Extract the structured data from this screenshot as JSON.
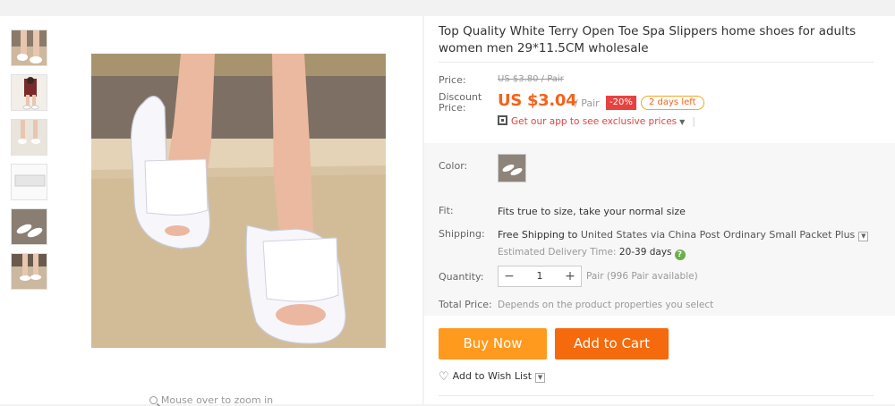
{
  "gallery": {
    "zoom_hint": "Mouse over to zoom in",
    "thumbnails": [
      "slippers-worn-1",
      "slippers-model",
      "slippers-pair",
      "slippers-packaged",
      "slippers-floor",
      "slippers-worn-2"
    ]
  },
  "product": {
    "title": "Top Quality White Terry Open Toe Spa Slippers home shoes for adults women men 29*11.5CM wholesale"
  },
  "price": {
    "price_label": "Price:",
    "original": "US $3.80 / Pair",
    "discount_label_1": "Discount",
    "discount_label_2": "Price:",
    "discount_value": "US $3.04",
    "per_unit": "/ Pair",
    "discount_pct": "-20%",
    "days_left": "2 days left",
    "app_link": "Get our app to see exclusive prices"
  },
  "props": {
    "color_label": "Color:",
    "fit_label": "Fit:",
    "fit_value": "Fits true to size, take your normal size",
    "shipping_label": "Shipping:",
    "shipping_free": "Free Shipping",
    "shipping_to": "to",
    "shipping_country": "United States via China Post Ordinary Small Packet Plus",
    "est_label": "Estimated Delivery Time:",
    "est_days": "20-39 days",
    "qty_label": "Quantity:",
    "qty_value": "1",
    "qty_available": "Pair (996 Pair available)",
    "total_label": "Total Price:",
    "total_value": "Depends on the product properties you select"
  },
  "actions": {
    "buy_now": "Buy Now",
    "add_to_cart": "Add to Cart",
    "wish_list": "Add to Wish List"
  },
  "colors": {
    "accent_orange": "#f5621a",
    "buy_button": "#ff9a1f",
    "cart_button": "#f56a0c",
    "badge_red": "#e64340"
  }
}
